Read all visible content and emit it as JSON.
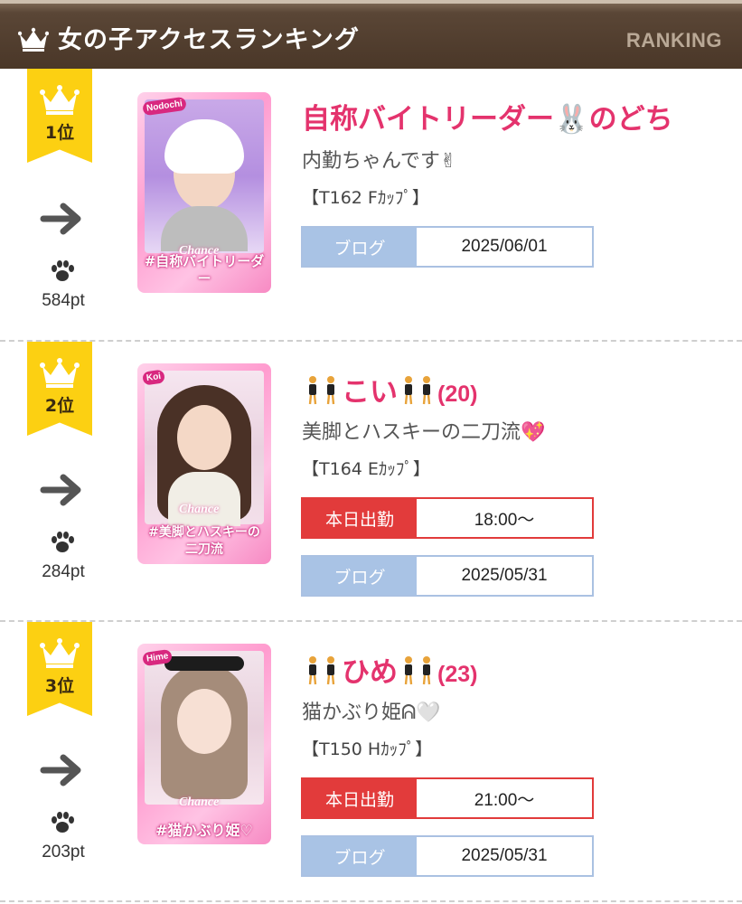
{
  "header": {
    "title": "女の子アクセスランキング",
    "tag": "RANKING",
    "crown_icon": "crown-icon"
  },
  "colors": {
    "header_bg": "#4a3728",
    "badge": "#fcd012",
    "name": "#e4336d",
    "blog_label": "#a9c3e5",
    "work_label": "#e23b3b"
  },
  "entries": [
    {
      "rank_label": "1位",
      "trend_icon": "arrow-right-icon",
      "points": "584pt",
      "photo_tag": "Nodochi",
      "photo_brand": "Chance",
      "photo_hashtag": "#自称バイトリーダー",
      "name": "自称バイトリーダー🐰のどち",
      "age": "",
      "catchcopy": "内勤ちゃんです✌",
      "spec": "【T162 Fｶｯﾌﾟ】",
      "work_label": "",
      "work_time": "",
      "blog_label": "ブログ",
      "blog_date": "2025/06/01"
    },
    {
      "rank_label": "2位",
      "trend_icon": "arrow-right-icon",
      "points": "284pt",
      "photo_tag": "Koi",
      "photo_brand": "Chance",
      "photo_hashtag": "#美脚とハスキーの二刀流",
      "name": "こい",
      "age": "(20)",
      "catchcopy": "美脚とハスキーの二刀流💖",
      "spec": "【T164 Eｶｯﾌﾟ】",
      "work_label": "本日出勤",
      "work_time": "18:00〜",
      "blog_label": "ブログ",
      "blog_date": "2025/05/31"
    },
    {
      "rank_label": "3位",
      "trend_icon": "arrow-right-icon",
      "points": "203pt",
      "photo_tag": "Hime",
      "photo_brand": "Chance",
      "photo_hashtag": "#猫かぶり姫♡",
      "name": "ひめ",
      "age": "(23)",
      "catchcopy": "猫かぶり姫ᕱ🤍",
      "spec": "【T150 Hｶｯﾌﾟ】",
      "work_label": "本日出勤",
      "work_time": "21:00〜",
      "blog_label": "ブログ",
      "blog_date": "2025/05/31"
    }
  ]
}
